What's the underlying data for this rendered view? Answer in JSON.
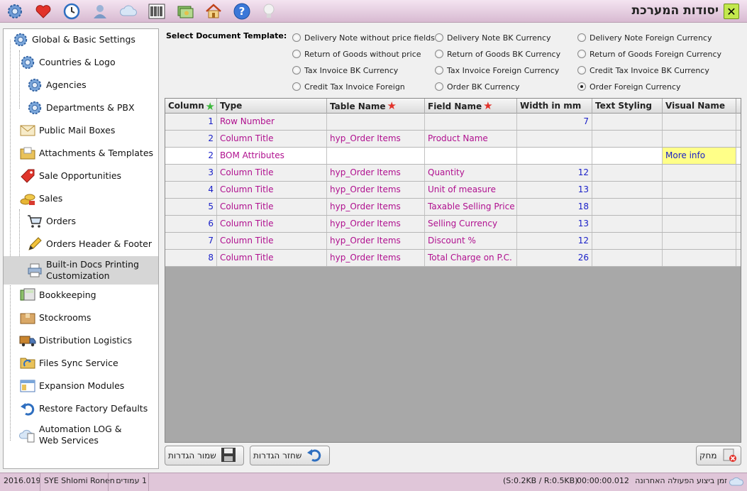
{
  "title": "יסודות המערכת",
  "colors": {
    "accent": "#c3e84d",
    "topbar": "#d8bad2",
    "pink_text": "#b0108f",
    "blue_text": "#1a20c8",
    "highlight": "#ffff88"
  },
  "toolbar_icons": [
    "gear-icon",
    "heart-icon",
    "clock-icon",
    "user-icon",
    "cloud-icon",
    "barcode-icon",
    "money-icon",
    "home-icon",
    "help-icon",
    "bulb-icon"
  ],
  "nav": [
    {
      "label": "Global & Basic Settings",
      "icon": "gear-icon"
    },
    {
      "label": "Countries & Logo",
      "icon": "gear-icon"
    },
    {
      "label": "Agencies",
      "icon": "gear-icon"
    },
    {
      "label": "Departments & PBX",
      "icon": "gear-icon"
    },
    {
      "label": "Public Mail Boxes",
      "icon": "mail-icon"
    },
    {
      "label": "Attachments & Templates",
      "icon": "folder-icon"
    },
    {
      "label": "Sale Opportunities",
      "icon": "tag-icon"
    },
    {
      "label": "Sales",
      "icon": "coins-icon"
    },
    {
      "label": "Orders",
      "icon": "cart-icon"
    },
    {
      "label": "Orders Header & Footer",
      "icon": "pencil-icon"
    },
    {
      "label": "Built-in Docs Printing",
      "label2": "Customization",
      "icon": "printer-icon"
    },
    {
      "label": "Bookkeeping",
      "icon": "calculator-icon"
    },
    {
      "label": "Stockrooms",
      "icon": "box-icon"
    },
    {
      "label": "Distribution Logistics",
      "icon": "truck-icon"
    },
    {
      "label": "Files Sync Service",
      "icon": "sync-icon"
    },
    {
      "label": "Expansion Modules",
      "icon": "window-icon"
    },
    {
      "label": "Restore Factory Defaults",
      "icon": "undo-icon"
    },
    {
      "label": "Automation LOG &",
      "label2": "Web Services",
      "icon": "cloud-doc-icon"
    }
  ],
  "template_label": "Select Document Template:",
  "templates": [
    {
      "label": "Delivery Note without price fields",
      "checked": false
    },
    {
      "label": "Delivery Note BK Currency",
      "checked": false
    },
    {
      "label": "Delivery Note Foreign Currency",
      "checked": false
    },
    {
      "label": "Return of Goods without price",
      "checked": false
    },
    {
      "label": "Return of Goods BK Currency",
      "checked": false
    },
    {
      "label": "Return of Goods Foreign Currency",
      "checked": false
    },
    {
      "label": "Tax Invoice BK Currency",
      "checked": false
    },
    {
      "label": "Tax Invoice Foreign Currency",
      "checked": false
    },
    {
      "label": "Credit Tax Invoice BK Currency",
      "checked": false
    },
    {
      "label": "Credit Tax Invoice Foreign",
      "checked": false
    },
    {
      "label": "Order BK Currency",
      "checked": false
    },
    {
      "label": "Order Foreign Currency",
      "checked": true
    }
  ],
  "columns": [
    "Column",
    "Type",
    "Table Name",
    "Field Name",
    "Width in mm",
    "Text Styling",
    "Visual Name"
  ],
  "rows": [
    {
      "column": "1",
      "type": "Row Number",
      "table": "",
      "field": "",
      "width": "7",
      "styling": "",
      "visual": ""
    },
    {
      "column": "2",
      "type": "Column Title",
      "table": "hyp_Order Items",
      "field": "Product Name",
      "width": "",
      "styling": "",
      "visual": ""
    },
    {
      "column": "2",
      "type": "BOM Attributes",
      "table": "",
      "field": "",
      "width": "",
      "styling": "",
      "visual": "More info"
    },
    {
      "column": "3",
      "type": "Column Title",
      "table": "hyp_Order Items",
      "field": "Quantity",
      "width": "12",
      "styling": "",
      "visual": ""
    },
    {
      "column": "4",
      "type": "Column Title",
      "table": "hyp_Order Items",
      "field": "Unit of measure",
      "width": "13",
      "styling": "",
      "visual": ""
    },
    {
      "column": "5",
      "type": "Column Title",
      "table": "hyp_Order Items",
      "field": "Taxable Selling Price",
      "width": "18",
      "styling": "",
      "visual": ""
    },
    {
      "column": "6",
      "type": "Column Title",
      "table": "hyp_Order Items",
      "field": "Selling Currency",
      "width": "13",
      "styling": "",
      "visual": ""
    },
    {
      "column": "7",
      "type": "Column Title",
      "table": "hyp_Order Items",
      "field": "Discount %",
      "width": "12",
      "styling": "",
      "visual": ""
    },
    {
      "column": "8",
      "type": "Column Title",
      "table": "hyp_Order Items",
      "field": "Total Charge on P.C.",
      "width": "26",
      "styling": "",
      "visual": ""
    }
  ],
  "buttons": {
    "save": "שמור הגדרות",
    "restore": "שחזר הגדרות",
    "delete": "מחק"
  },
  "status": {
    "version": "2016.019",
    "user": "SYE Shlomi Ronen",
    "pages": "1 עמודים",
    "sizes": "(S:0.2KB / R:0.5KB)",
    "time": "00:00:00.012",
    "time_label": "זמן ביצוע הפעולה האחרונה"
  }
}
